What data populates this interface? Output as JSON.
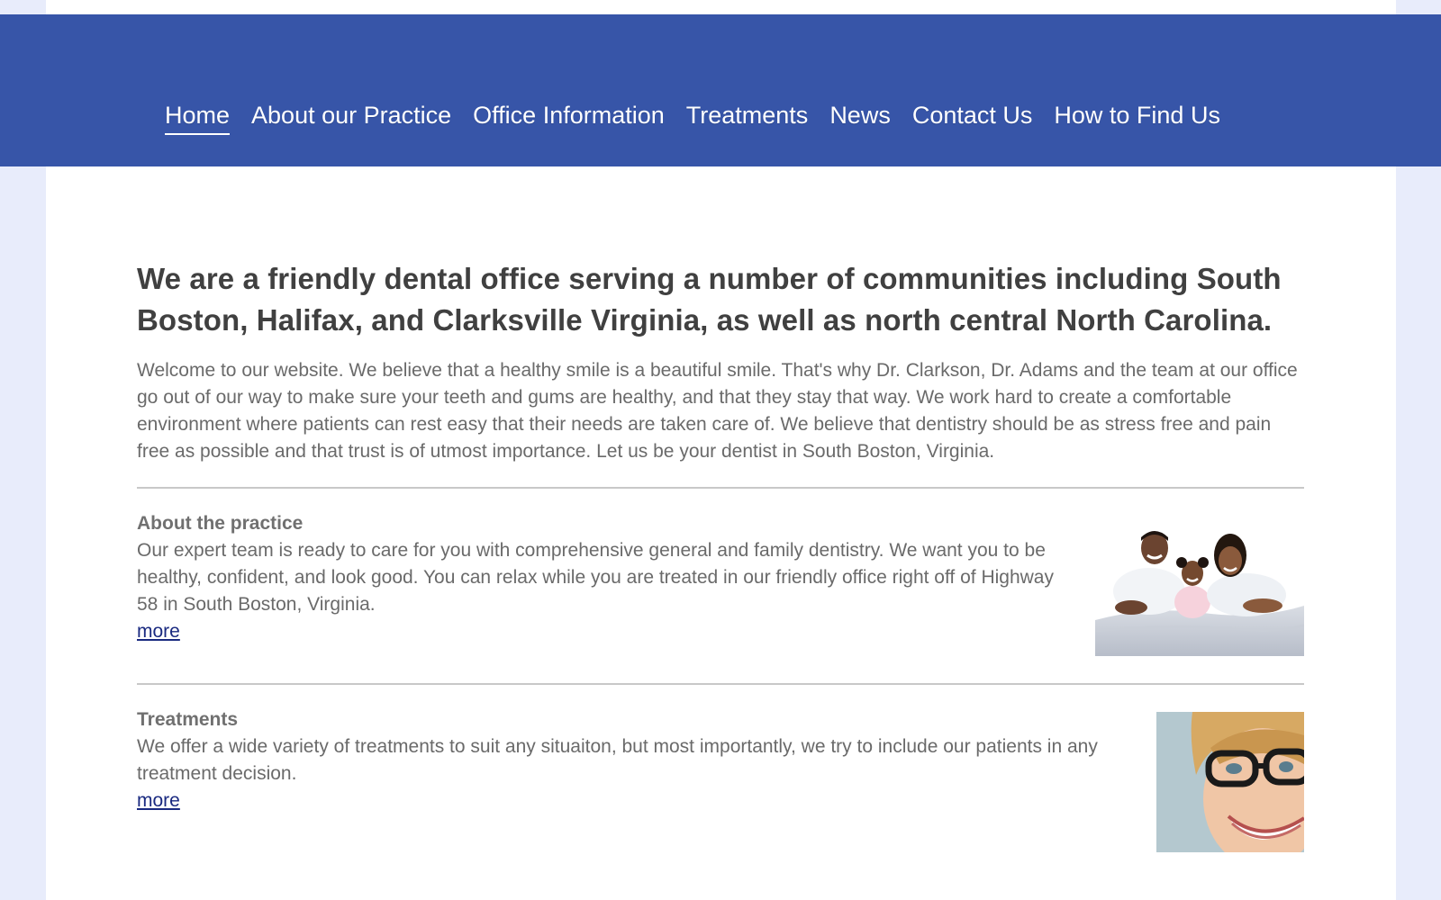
{
  "nav": {
    "items": [
      {
        "label": "Home",
        "active": true
      },
      {
        "label": "About our Practice",
        "active": false
      },
      {
        "label": "Office Information",
        "active": false
      },
      {
        "label": "Treatments",
        "active": false
      },
      {
        "label": "News",
        "active": false
      },
      {
        "label": "Contact Us",
        "active": false
      },
      {
        "label": "How to Find Us",
        "active": false
      }
    ]
  },
  "main": {
    "headline": "We are a friendly dental office serving a number of communities including South Boston, Halifax, and Clarksville Virginia, as well as north central North Carolina.",
    "intro": "Welcome to our website. We believe that a healthy smile is a beautiful smile. That's why Dr. Clarkson, Dr. Adams and the team at our office go out of our way to make sure your teeth and gums are healthy, and that they stay that way.  We work hard to create a comfortable environment where patients can rest easy that their needs are taken care of.  We believe that dentistry should be as stress free and pain free as possible and that trust is of utmost importance. Let us be your dentist in South Boston, Virginia.",
    "sections": [
      {
        "title": "About the practice",
        "body": "Our expert team is ready to care for you with comprehensive general and family dentistry.  We want you to be healthy, confident, and look good.  You can relax while you are treated in our friendly office right off of Highway 58 in South Boston, Virginia.",
        "link": "more"
      },
      {
        "title": "Treatments",
        "body": "We offer a wide variety of treatments to suit any situaiton, but most importantly, we try to include our patients in any treatment decision.",
        "link": "more"
      }
    ]
  },
  "colors": {
    "nav_background": "#3755a8",
    "page_background": "#e8ecfb",
    "link": "#1a2a80"
  }
}
